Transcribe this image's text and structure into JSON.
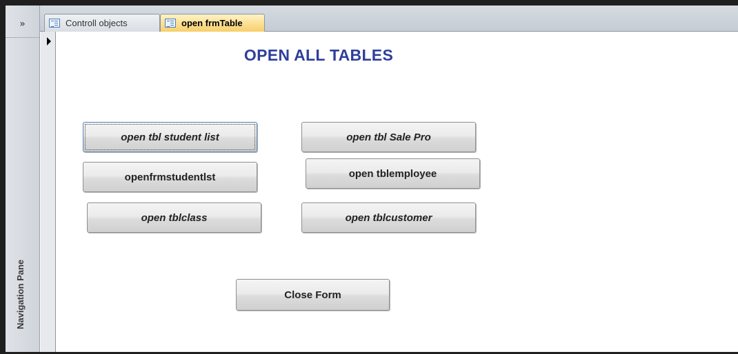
{
  "nav_pane": {
    "toggle": "»",
    "label": "Navigation Pane"
  },
  "tabs": [
    {
      "label": "Controll objects",
      "active": false
    },
    {
      "label": "open frmTable",
      "active": true
    }
  ],
  "form": {
    "title": "OPEN ALL TABLES",
    "buttons": {
      "student_list": "open tbl student list",
      "sale_pro": "open tbl Sale Pro",
      "frm_student": "openfrmstudentlst",
      "employee": "open tblemployee",
      "class": "open tblclass",
      "customer": "open tblcustomer",
      "close": "Close Form"
    }
  },
  "colors": {
    "title": "#2e3f9b",
    "active_tab": "#f7cf6b",
    "frame": "#1f1f1f"
  }
}
